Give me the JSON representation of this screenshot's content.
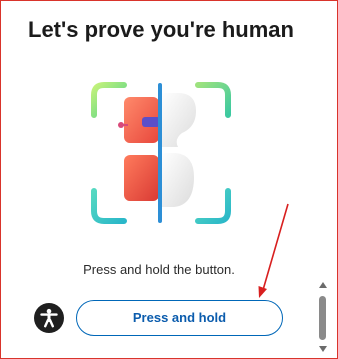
{
  "dialog": {
    "title": "Let's prove you're human",
    "instruction": "Press and hold the button.",
    "hold_button_label": "Press and hold"
  },
  "icons": {
    "illustration": "puzzle-scan-illustration-icon",
    "accessibility": "accessibility-person-icon",
    "annotation": "red-arrow-icon"
  },
  "colors": {
    "frame_border": "#d9342b",
    "title_text": "#1b1b1b",
    "button_border": "#0067b8",
    "button_text": "#0b5cad",
    "scan_line": "#2d8fd6",
    "annotation_arrow": "#d81f1f"
  }
}
